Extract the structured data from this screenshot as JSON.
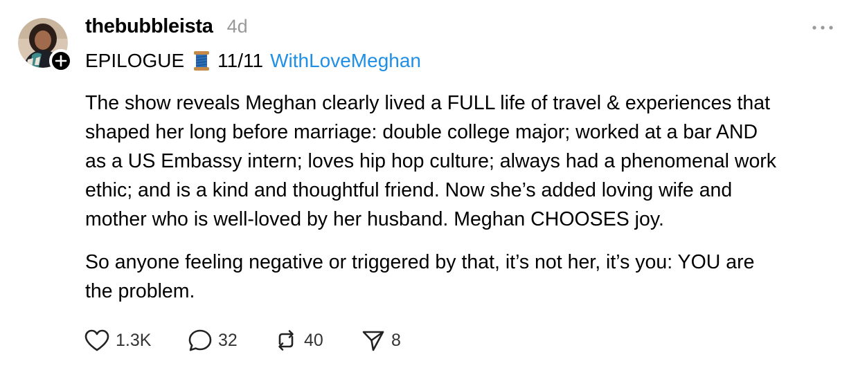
{
  "post": {
    "username": "thebubbleista",
    "timestamp": "4d",
    "title": {
      "text": "EPILOGUE",
      "emoji": "spool-of-thread-icon",
      "part": "11/11",
      "tag": "WithLoveMeghan"
    },
    "body": {
      "paragraph_1": "The show reveals Meghan clearly lived a FULL life of travel & experiences that\nshaped her long before marriage: double college major; worked at a bar AND\nas a US Embassy intern; loves hip hop culture; always had a phenomenal work\nethic; and is a kind and thoughtful friend. Now she’s added loving wife and\nmother who is well-loved by her husband. Meghan CHOOSES joy.",
      "paragraph_2": "So anyone feeling negative or triggered by that, it’s not her, it’s you: YOU are\nthe problem."
    },
    "actions": {
      "likes": "1.3K",
      "replies": "32",
      "reposts": "40",
      "shares": "8"
    }
  },
  "colors": {
    "text": "#000000",
    "timestamp": "#999999",
    "link": "#1f8fe6",
    "action_text": "#333333"
  },
  "icons": {
    "more": "more-options-icon",
    "follow": "plus-icon",
    "like": "heart-icon",
    "reply": "comment-bubble-icon",
    "repost": "repost-icon",
    "share": "send-icon"
  }
}
